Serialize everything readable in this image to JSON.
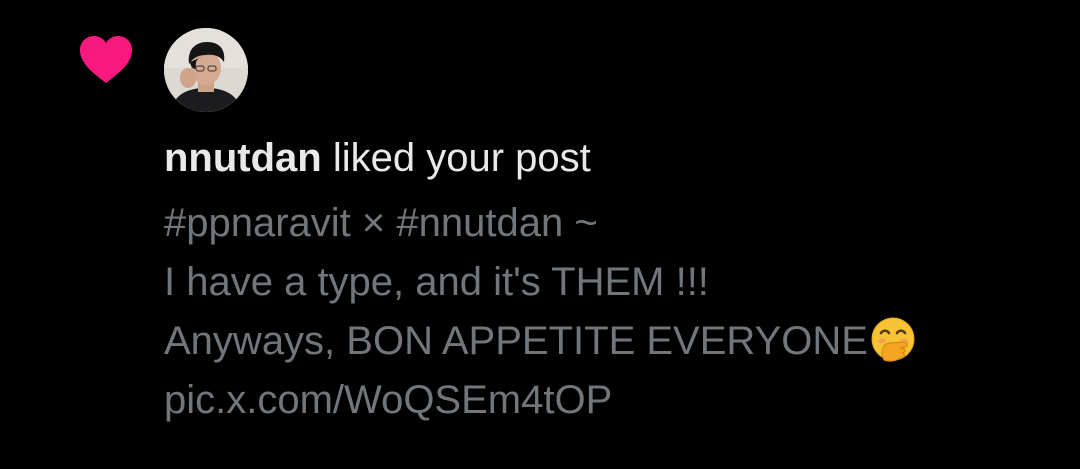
{
  "notification": {
    "type_icon": "heart-icon",
    "accent_color": "#f91880",
    "avatar": "user-avatar",
    "username": "nnutdan",
    "action_text": " liked your post",
    "post_lines": [
      "#ppnaravit × #nnutdan ~",
      "I have a type, and it's THEM !!!",
      "Anyways, BON APPETITE EVERYONE",
      "pic.x.com/WoQSEm4tOP"
    ],
    "emoji": "face-with-hand-over-mouth-emoji"
  }
}
